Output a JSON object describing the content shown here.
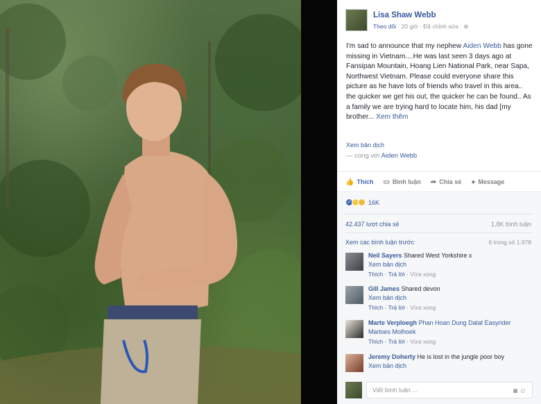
{
  "post": {
    "author": "Lisa Shaw Webb",
    "follow": "Theo dõi",
    "time": "20 giờ",
    "edited": "Đã chỉnh sửa",
    "text_pre": "I'm sad to announce that my nephew ",
    "text_link": "Aiden Webb",
    "text_post": " has gone missing in Vietnam....He was last seen 3 days ago at Fansipan Mountain, Hoang Lien National Park, near Sapa, Northwest Vietnam. Please could everyone share this picture as he have lots of friends who travel in this area.. the quicker we get his out, the quicker he can be found.. As a family we are trying hard to locate him, his dad [my brother... ",
    "see_more": "Xem thêm",
    "see_translation": "Xem bản dịch",
    "with_prefix": "— cùng với ",
    "with_name": "Aiden Webb"
  },
  "actions": {
    "like": "Thích",
    "comment": "Bình luận",
    "share": "Chia sẻ",
    "message": "Message"
  },
  "stats": {
    "reactions": "16K",
    "shares": "42.437 lượt chia sẻ",
    "comments": "1,8K bình luận",
    "prev_comments": "Xem các bình luận trước",
    "pager": "6 trong số 1.978"
  },
  "comments": [
    {
      "name": "Neil Sayers",
      "text": " Shared West Yorkshire x",
      "trans": "Xem bản dịch",
      "like": "Thích",
      "reply": "Trả lời",
      "time": "Vừa xong"
    },
    {
      "name": "Gill James",
      "text": " Shared devon",
      "trans": "Xem bản dịch",
      "like": "Thích",
      "reply": "Trả lời",
      "time": "Vừa xong"
    },
    {
      "name": "Marte Verploegh",
      "text": " Phan Hoan Dung Dalat Easyrider Marloes Molhoek",
      "trans": "",
      "like": "Thích",
      "reply": "Trả lời",
      "time": "Vừa xong"
    },
    {
      "name": "Jeremy Doherty",
      "text": " He is lost in the jungle poor boy",
      "trans": "Xem bản dịch",
      "like": "",
      "reply": "",
      "time": ""
    }
  ],
  "write": {
    "placeholder": "Viết bình luận ..."
  },
  "icons": [
    "like-icon",
    "comment-icon",
    "share-icon",
    "message-icon",
    "camera-icon",
    "emoji-icon"
  ],
  "colors": {
    "link": "#365899",
    "like_active": "#4267b2",
    "muted": "#90949c"
  }
}
